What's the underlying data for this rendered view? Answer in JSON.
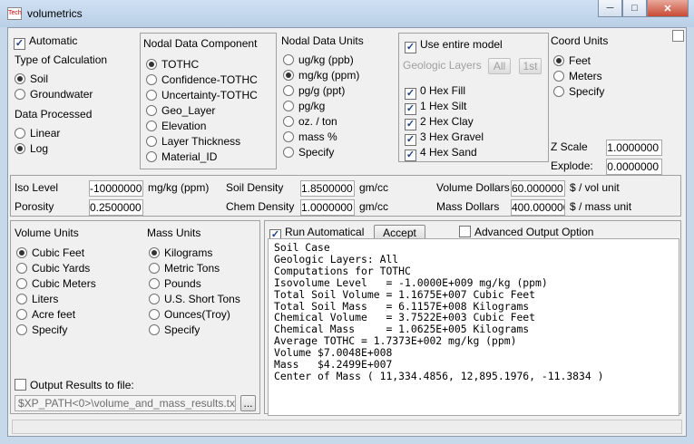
{
  "window": {
    "title": "volumetrics",
    "icon_text": "Tech"
  },
  "calc": {
    "automatic": "Automatic",
    "type_title": "Type of Calculation",
    "types": [
      "Soil",
      "Groundwater"
    ],
    "processed_title": "Data Processed",
    "processed": [
      "Linear",
      "Log"
    ]
  },
  "nodal_component": {
    "title": "Nodal Data Component",
    "options": [
      "TOTHC",
      "Confidence-TOTHC",
      "Uncertainty-TOTHC",
      "Geo_Layer",
      "Elevation",
      "Layer Thickness",
      "Material_ID"
    ]
  },
  "nodal_units": {
    "title": "Nodal Data Units",
    "options": [
      "ug/kg (ppb)",
      "mg/kg (ppm)",
      "pg/g (ppt)",
      "pg/kg",
      "oz. / ton",
      "mass %",
      "Specify"
    ]
  },
  "model": {
    "use_entire": "Use entire model",
    "geologic_layers": "Geologic Layers",
    "all_btn": "All",
    "first_btn": "1st",
    "layers": [
      "0 Hex Fill",
      "1 Hex Silt",
      "2 Hex Clay",
      "3 Hex Gravel",
      "4 Hex Sand"
    ]
  },
  "coord": {
    "title": "Coord Units",
    "options": [
      "Feet",
      "Meters",
      "Specify"
    ],
    "z_scale_label": "Z Scale",
    "z_scale": "1.0000000",
    "explode_label": "Explode:",
    "explode": "0.0000000"
  },
  "params": {
    "iso_level_label": "Iso Level",
    "iso_level": "-10000000",
    "iso_unit": "mg/kg (ppm)",
    "porosity_label": "Porosity",
    "porosity": "0.2500000",
    "soil_density_label": "Soil Density",
    "soil_density": "1.8500000",
    "soil_density_unit": "gm/cc",
    "chem_density_label": "Chem Density",
    "chem_density": "1.0000000",
    "chem_density_unit": "gm/cc",
    "volume_dollars_label": "Volume Dollars",
    "volume_dollars": "60.000000",
    "volume_dollars_unit": "$ / vol unit",
    "mass_dollars_label": "Mass Dollars",
    "mass_dollars": "400.000000",
    "mass_dollars_unit": "$ / mass unit"
  },
  "volume_units": {
    "title": "Volume Units",
    "options": [
      "Cubic Feet",
      "Cubic Yards",
      "Cubic Meters",
      "Liters",
      "Acre feet",
      "Specify"
    ]
  },
  "mass_units": {
    "title": "Mass Units",
    "options": [
      "Kilograms",
      "Metric Tons",
      "Pounds",
      "U.S. Short Tons",
      "Ounces(Troy)",
      "Specify"
    ]
  },
  "output_file": {
    "label": "Output Results to file:",
    "path": "$XP_PATH<0>\\volume_and_mass_results.txt",
    "browse": "..."
  },
  "run": {
    "run_auto": "Run Automatical",
    "accept": "Accept",
    "advanced": "Advanced Output Option"
  },
  "results": {
    "lines": [
      "Soil Case",
      "Geologic Layers: All",
      "Computations for TOTHC",
      "Isovolume Level   = -1.0000E+009 mg/kg (ppm)",
      "Total Soil Volume = 1.1675E+007 Cubic Feet",
      "Total Soil Mass   = 6.1157E+008 Kilograms",
      "Chemical Volume   = 3.7522E+003 Cubic Feet",
      "Chemical Mass     = 1.0625E+005 Kilograms",
      "Average TOTHC = 1.7373E+002 mg/kg (ppm)",
      "Volume $7.0048E+008",
      "Mass   $4.2499E+007",
      "Center of Mass ( 11,334.4856, 12,895.1976, -11.3834 )"
    ]
  }
}
